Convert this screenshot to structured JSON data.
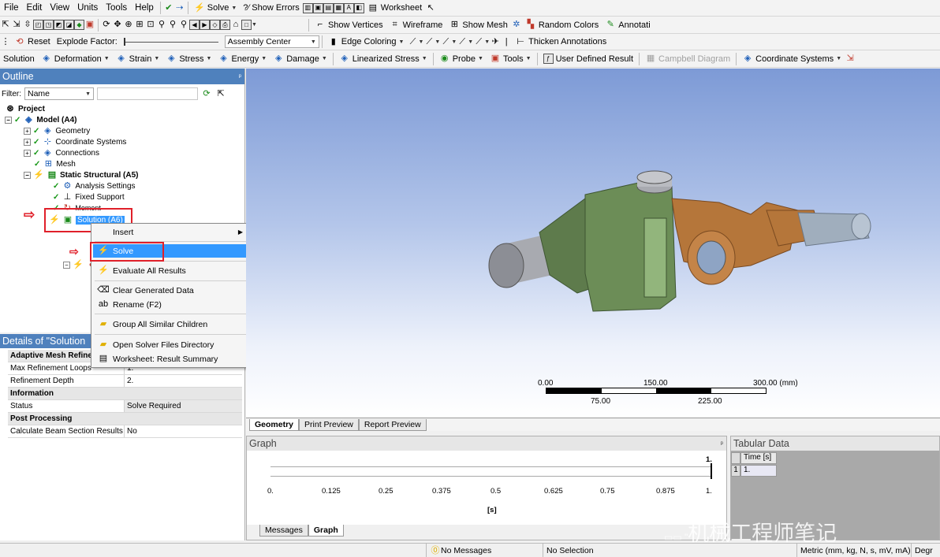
{
  "menu": [
    "File",
    "Edit",
    "View",
    "Units",
    "Tools",
    "Help"
  ],
  "toolbar1": {
    "solve": "Solve",
    "show_errors": "?⁄ Show Errors",
    "worksheet": "Worksheet"
  },
  "toolbar2": {
    "show_vertices": "Show Vertices",
    "wireframe": "Wireframe",
    "show_mesh": "Show Mesh",
    "random_colors": "Random Colors",
    "annotations": "Annotati"
  },
  "toolbar3": {
    "reset": "Reset",
    "explode_factor": "Explode Factor:",
    "assembly_center": "Assembly Center",
    "edge_coloring": "Edge Coloring",
    "thicken_annotations": "Thicken Annotations"
  },
  "toolbar4": {
    "solution": "Solution",
    "deformation": "Deformation",
    "strain": "Strain",
    "stress": "Stress",
    "energy": "Energy",
    "damage": "Damage",
    "linearized_stress": "Linearized Stress",
    "probe": "Probe",
    "tools": "Tools",
    "user_defined_result": "User Defined Result",
    "campbell_diagram": "Campbell Diagram",
    "coordinate_systems": "Coordinate Systems"
  },
  "outline": {
    "title": "Outline",
    "filter_label": "Filter:",
    "filter_value": "Name",
    "tree": {
      "project": "Project",
      "model": "Model (A4)",
      "geometry": "Geometry",
      "coordinate_systems": "Coordinate Systems",
      "connections": "Connections",
      "mesh": "Mesh",
      "static_structural": "Static Structural (A5)",
      "analysis_settings": "Analysis Settings",
      "fixed_support": "Fixed Support",
      "moment": "Moment",
      "solution": "Solution (A6)"
    }
  },
  "context_menu": {
    "insert": "Insert",
    "solve": "Solve",
    "evaluate_all": "Evaluate All Results",
    "clear_generated": "Clear Generated Data",
    "rename": "Rename (F2)",
    "group_similar": "Group All Similar Children",
    "open_solver_dir": "Open Solver Files Directory",
    "worksheet_summary": "Worksheet: Result Summary"
  },
  "details": {
    "title": "Details of \"Solution",
    "adaptive_group": "Adaptive Mesh Refine",
    "rows": [
      {
        "key": "Max Refinement Loops",
        "value": "1."
      },
      {
        "key": "Refinement Depth",
        "value": "2."
      }
    ],
    "information_group": "Information",
    "status_key": "Status",
    "status_value": "Solve Required",
    "post_group": "Post Processing",
    "beam_key": "Calculate Beam Section Results",
    "beam_value": "No"
  },
  "viewport": {
    "scale_top": [
      "0.00",
      "150.00",
      "300.00 (mm)"
    ],
    "scale_bottom": [
      "75.00",
      "225.00"
    ],
    "colors": {
      "green_part": "#5e7b4c",
      "orange_part": "#b5763a",
      "shaft": "#a8aab0"
    }
  },
  "tabs": [
    "Geometry",
    "Print Preview",
    "Report Preview"
  ],
  "graph": {
    "title": "Graph",
    "top_value": "1.",
    "ticks": [
      "0.",
      "0.125",
      "0.25",
      "0.375",
      "0.5",
      "0.625",
      "0.75",
      "0.875",
      "1."
    ],
    "unit": "[s]",
    "tabs": [
      "Messages",
      "Graph"
    ]
  },
  "tabular": {
    "title": "Tabular Data",
    "header": "Time [s]",
    "row_index": "1",
    "row_value": "1."
  },
  "status": {
    "messages": "No Messages",
    "selection": "No Selection",
    "units": "Metric (mm, kg, N, s, mV, mA)",
    "degrees": "Degr"
  },
  "watermark": "机械工程师笔记"
}
